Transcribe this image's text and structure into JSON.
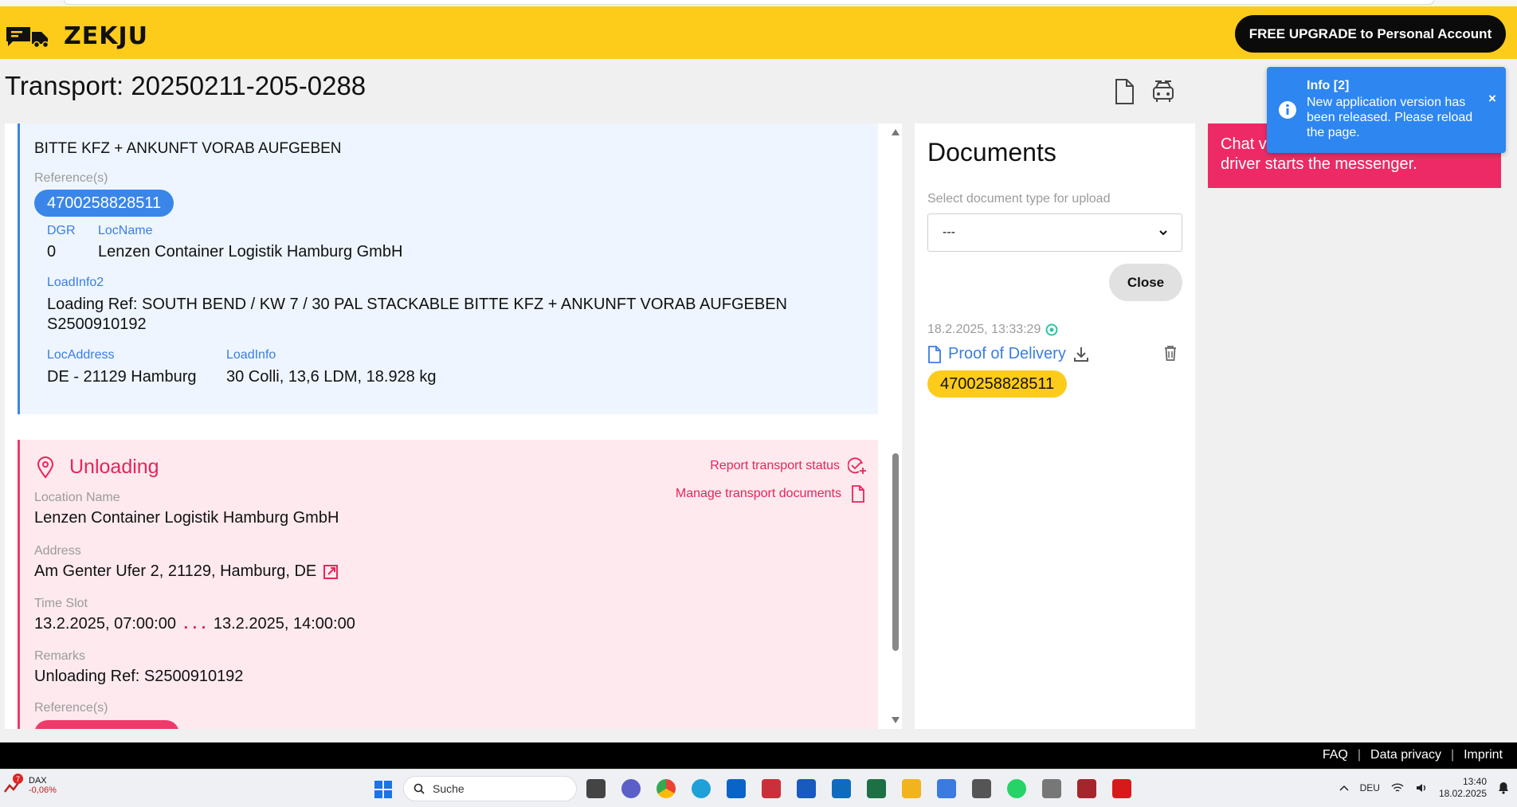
{
  "header": {
    "logo_text": "ZEKJU",
    "upgrade_label": "FREE UPGRADE to Personal Account"
  },
  "page": {
    "title": "Transport: 20250211-205-0288"
  },
  "loading": {
    "remark_text": "BITTE KFZ + ANKUNFT VORAB AUFGEBEN",
    "references_label": "Reference(s)",
    "reference": "4700258828511",
    "dgr_label": "DGR",
    "dgr_value": "0",
    "locname_label": "LocName",
    "locname_value": "Lenzen Container Logistik Hamburg GmbH",
    "loadinfo2_label": "LoadInfo2",
    "loadinfo2_value_line1": "Loading Ref: SOUTH BEND / KW 7 / 30 PAL STACKABLE BITTE KFZ + ANKUNFT VORAB AUFGEBEN",
    "loadinfo2_value_line2": "S2500910192",
    "locaddress_label": "LocAddress",
    "locaddress_value": "DE - 21129 Hamburg",
    "loadinfo_label": "LoadInfo",
    "loadinfo_value": "30 Colli, 13,6 LDM, 18.928 kg"
  },
  "unloading": {
    "heading": "Unloading",
    "report_status_label": "Report transport status",
    "manage_docs_label": "Manage transport documents",
    "location_name_label": "Location Name",
    "location_name_value": "Lenzen Container Logistik Hamburg GmbH",
    "address_label": "Address",
    "address_value": "Am Genter Ufer 2, 21129, Hamburg, DE",
    "timeslot_label": "Time Slot",
    "timeslot_start": "13.2.2025, 07:00:00",
    "timeslot_sep": ". . .",
    "timeslot_end": "13.2.2025, 14:00:00",
    "remarks_label": "Remarks",
    "remarks_value": "Unloading Ref: S2500910192",
    "references_label": "Reference(s)"
  },
  "documents": {
    "title": "Documents",
    "select_label": "Select document type for upload",
    "select_value": "---",
    "close_label": "Close",
    "entry_time": "18.2.2025, 13:33:29",
    "entry_name": "Proof of Delivery",
    "entry_reference": "4700258828511"
  },
  "chat_banner": {
    "line1": "Chat v",
    "line2": "driver starts the messenger."
  },
  "toast": {
    "title": "Info [2]",
    "message": "New application version has been released. Please reload the page.",
    "close": "×"
  },
  "footer": {
    "faq": "FAQ",
    "sep": "|",
    "privacy": "Data privacy",
    "imprint": "Imprint"
  },
  "taskbar": {
    "dax_badge": "7",
    "dax_name": "DAX",
    "dax_change": "-0,06%",
    "search_placeholder": "Suche",
    "language": "DEU",
    "time": "13:40",
    "date": "18.02.2025"
  },
  "colors": {
    "brand_yellow": "#fdcb1a",
    "accent_blue": "#3a86e8",
    "accent_pink": "#ee3a6a"
  }
}
